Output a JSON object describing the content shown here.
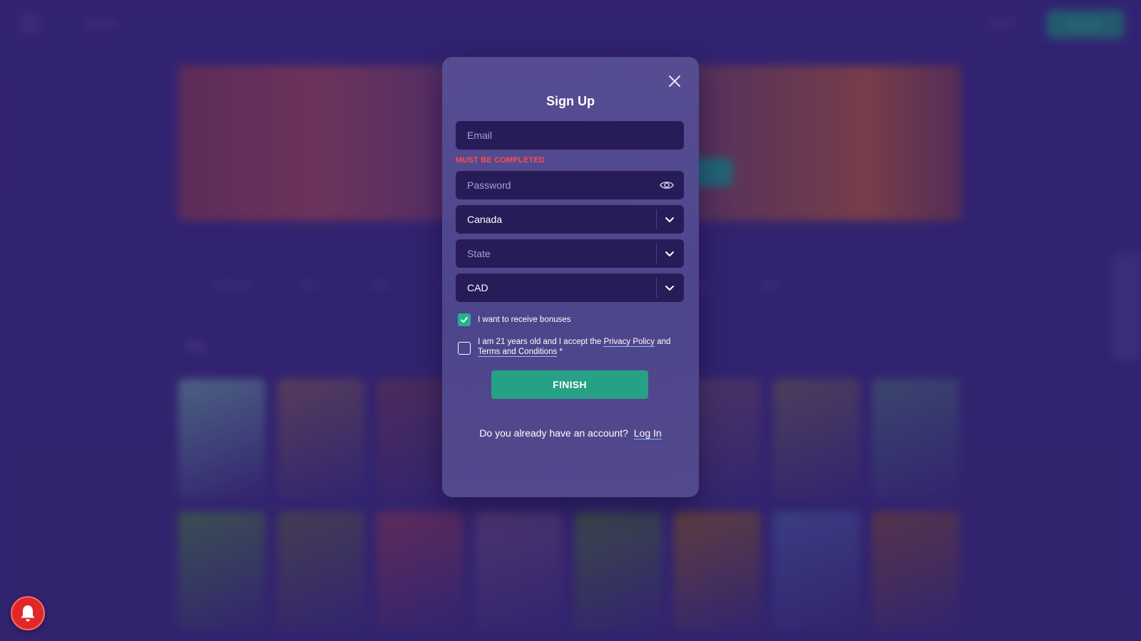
{
  "background": {
    "search_label": "Search",
    "login_label": "Log In",
    "register_label": "Register",
    "section_label": "Top",
    "tabs": [
      "Featured",
      "New",
      "Slots",
      "Live",
      "Jackpots",
      "Table",
      "Bonus Buy",
      "More"
    ],
    "tile_colors": [
      "#6a9aa0",
      "#7a5a5a",
      "#6a3a5a",
      "#5a3a7a",
      "#5a3a6a",
      "#6a4a6a",
      "#6a5a5a",
      "#4a6a7a",
      "#4a7a4a",
      "#5a5a4a",
      "#8a3a5a",
      "#6a4a7a",
      "#4a6a3a",
      "#8a5a2a",
      "#4a5aa0",
      "#7a4a3a"
    ]
  },
  "modal": {
    "title": "Sign Up",
    "email_placeholder": "Email",
    "error_message": "MUST BE COMPLETED",
    "password_placeholder": "Password",
    "country_value": "Canada",
    "state_placeholder": "State",
    "currency_value": "CAD",
    "bonus_label": "I want to receive bonuses",
    "bonus_checked": true,
    "age_text_1": "I am 21 years old and I accept the ",
    "privacy_link": "Privacy Policy",
    "age_text_2": " and ",
    "terms_link": "Terms and Conditions",
    "age_required_mark": " *",
    "age_checked": false,
    "finish_label": "FINISH",
    "account_prompt": "Do you already have an account?",
    "login_link": "Log In"
  },
  "colors": {
    "accent": "#27a186",
    "error": "#ff4d4d",
    "field_bg": "#271c58",
    "bell": "#e02828"
  },
  "icons": {
    "close": "close-icon",
    "eye": "eye-icon",
    "chevron": "chevron-down-icon",
    "check": "checkmark-icon",
    "bell": "bell-icon"
  }
}
